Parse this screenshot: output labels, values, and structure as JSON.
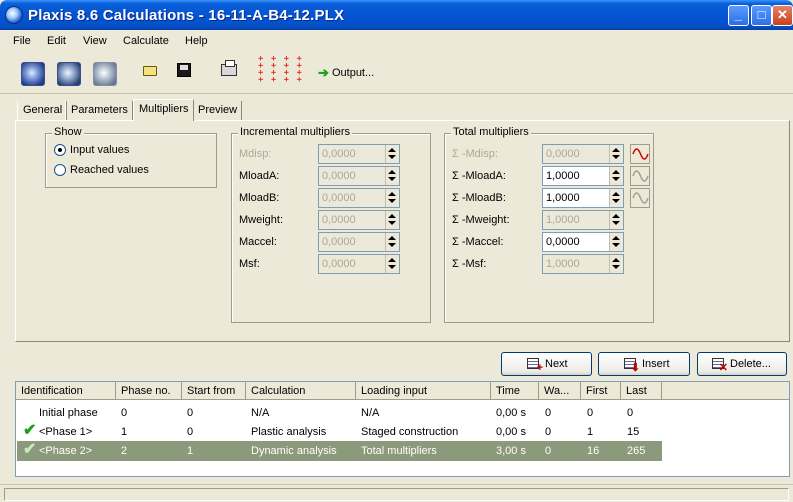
{
  "window": {
    "title": "Plaxis 8.6 Calculations - 16-11-A-B4-12.PLX",
    "minimize": "_",
    "maximize": "□",
    "close": "✕"
  },
  "menu": [
    "File",
    "Edit",
    "View",
    "Calculate",
    "Help"
  ],
  "toolbar": {
    "dots": "+ + + +\n+ + + +\n+ + + +\n+ + + +",
    "output_label": "Output...",
    "output_arrow": "➔"
  },
  "tabs": [
    "General",
    "Parameters",
    "Multipliers",
    "Preview"
  ],
  "active_tab": "Multipliers",
  "show_group": {
    "title": "Show",
    "options": [
      {
        "label": "Input values",
        "checked": true
      },
      {
        "label": "Reached values",
        "checked": false
      }
    ]
  },
  "incremental": {
    "title": "Incremental multipliers",
    "rows": [
      {
        "label": "Mdisp:",
        "value": "0,0000",
        "enabled": false
      },
      {
        "label": "MloadA:",
        "value": "0,0000",
        "enabled": false
      },
      {
        "label": "MloadB:",
        "value": "0,0000",
        "enabled": false
      },
      {
        "label": "Mweight:",
        "value": "0,0000",
        "enabled": false
      },
      {
        "label": "Maccel:",
        "value": "0,0000",
        "enabled": false
      },
      {
        "label": "Msf:",
        "value": "0,0000",
        "enabled": false
      }
    ]
  },
  "total": {
    "title": "Total multipliers",
    "rows": [
      {
        "label": "Σ -Mdisp:",
        "value": "0,0000",
        "enabled": false
      },
      {
        "label": "Σ -MloadA:",
        "value": "1,0000",
        "enabled": true
      },
      {
        "label": "Σ -MloadB:",
        "value": "1,0000",
        "enabled": true
      },
      {
        "label": "Σ -Mweight:",
        "value": "1,0000",
        "enabled": false
      },
      {
        "label": "Σ -Maccel:",
        "value": "0,0000",
        "enabled": true
      },
      {
        "label": "Σ -Msf:",
        "value": "1,0000",
        "enabled": false
      }
    ],
    "wave_colors": [
      "#d00000",
      "#a0a090",
      "#a0a090"
    ]
  },
  "buttons": {
    "next": "Next",
    "insert": "Insert",
    "delete": "Delete...",
    "next_mark": "+",
    "insert_mark": "⬇",
    "delete_mark": "✕"
  },
  "table": {
    "columns": [
      "Identification",
      "Phase no.",
      "Start from",
      "Calculation",
      "Loading input",
      "Time",
      "Wa...",
      "First",
      "Last"
    ],
    "rows": [
      {
        "check": "",
        "cells": [
          "Initial phase",
          "0",
          "0",
          "N/A",
          "N/A",
          "0,00 s",
          "0",
          "0",
          "0"
        ],
        "selected": false
      },
      {
        "check": "✔",
        "cells": [
          "<Phase 1>",
          "1",
          "0",
          "Plastic analysis",
          "Staged construction",
          "0,00 s",
          "0",
          "1",
          "15"
        ],
        "selected": false
      },
      {
        "check": "✔",
        "cells": [
          "<Phase 2>",
          "2",
          "1",
          "Dynamic analysis",
          "Total multipliers",
          "3,00 s",
          "0",
          "16",
          "265"
        ],
        "selected": true
      }
    ]
  }
}
